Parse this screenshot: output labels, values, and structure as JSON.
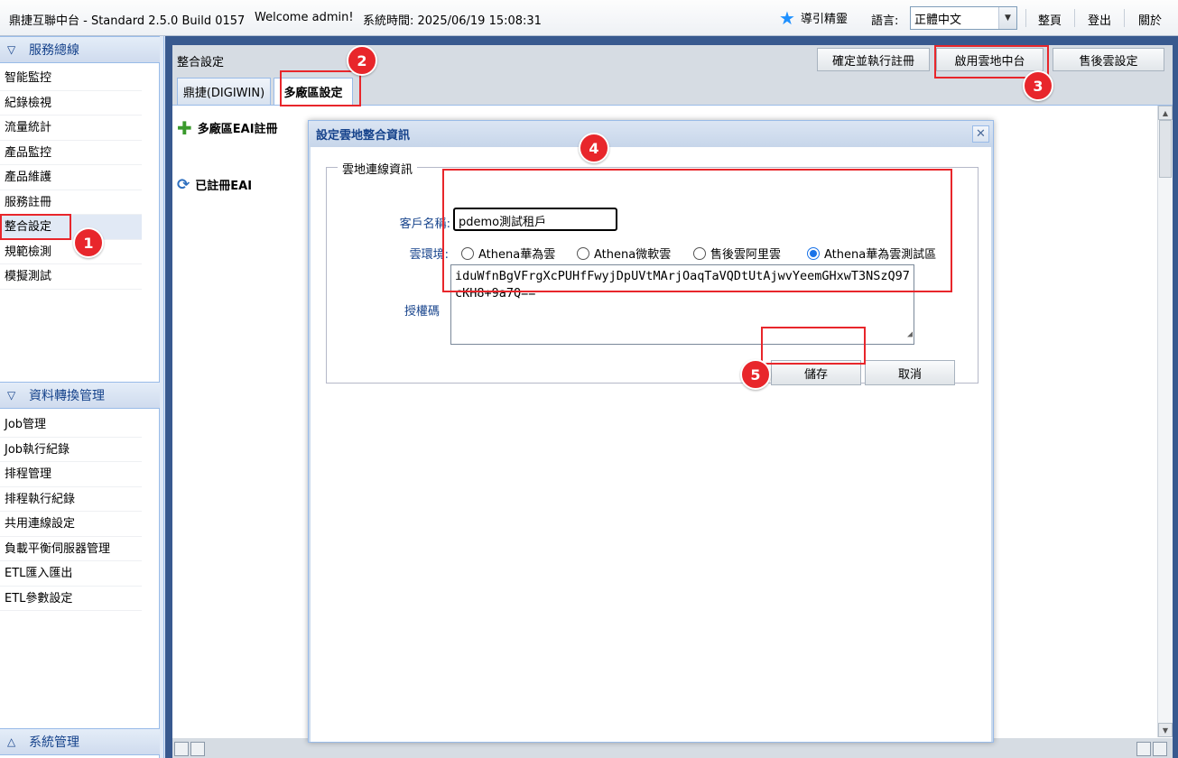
{
  "topbar": {
    "app_title": "鼎捷互聯中台 - Standard 2.5.0 Build 0157",
    "welcome": "Welcome admin!",
    "system_time": "系統時間: 2025/06/19 15:08:31",
    "guide_label": "導引精靈",
    "language_label": "語言:",
    "language_value": "正體中文",
    "home_link": "整頁",
    "logout_link": "登出",
    "about_link": "關於"
  },
  "sidebar": {
    "service_panel_title": "服務總線",
    "service_items": [
      {
        "label": "智能監控"
      },
      {
        "label": "紀錄檢視"
      },
      {
        "label": "流量統計"
      },
      {
        "label": "產品監控"
      },
      {
        "label": "產品維護"
      },
      {
        "label": "服務註冊"
      },
      {
        "label": "整合設定"
      },
      {
        "label": "規範檢測"
      },
      {
        "label": "模擬測試"
      }
    ],
    "data_panel_title": "資料轉換管理",
    "data_items": [
      {
        "label": "Job管理"
      },
      {
        "label": "Job執行紀錄"
      },
      {
        "label": "排程管理"
      },
      {
        "label": "排程執行紀錄"
      },
      {
        "label": "共用連線設定"
      },
      {
        "label": "負載平衡伺服器管理"
      },
      {
        "label": "ETL匯入匯出"
      },
      {
        "label": "ETL參數設定"
      }
    ],
    "system_panel_title": "系統管理"
  },
  "main": {
    "page_title": "整合設定",
    "buttons": {
      "confirm_register": "確定並執行註冊",
      "enable_cloud": "啟用雲地中台",
      "after_sales": "售後雲設定"
    },
    "tabs": [
      {
        "label": "鼎捷(DIGIWIN)"
      },
      {
        "label": "多廠區設定"
      }
    ],
    "links": {
      "register_eai": "多廠區EAI註冊",
      "registered_eai": "已註冊EAI"
    }
  },
  "dialog": {
    "title": "設定雲地整合資訊",
    "legend": "雲地連線資訊",
    "customer_label": "客戶名稱:",
    "customer_value": "pdemo測試租戶",
    "env_label": "雲環境:",
    "env_options": [
      {
        "label": "Athena華為雲",
        "checked": false
      },
      {
        "label": "Athena微軟雲",
        "checked": false
      },
      {
        "label": "售後雲阿里雲",
        "checked": false
      },
      {
        "label": "Athena華為雲測試區",
        "checked": true
      }
    ],
    "auth_label": "授權碼",
    "auth_value": "iduWfnBgVFrgXcPUHfFwyjDpUVtMArjOaqTaVQDtUtAjwvYeemGHxwT3NSzQ97cKH8+9a7Q==",
    "save_label": "儲存",
    "cancel_label": "取消"
  },
  "annotations": {
    "badge_color": "#e8262b",
    "steps": [
      "1",
      "2",
      "3",
      "4",
      "5"
    ]
  }
}
